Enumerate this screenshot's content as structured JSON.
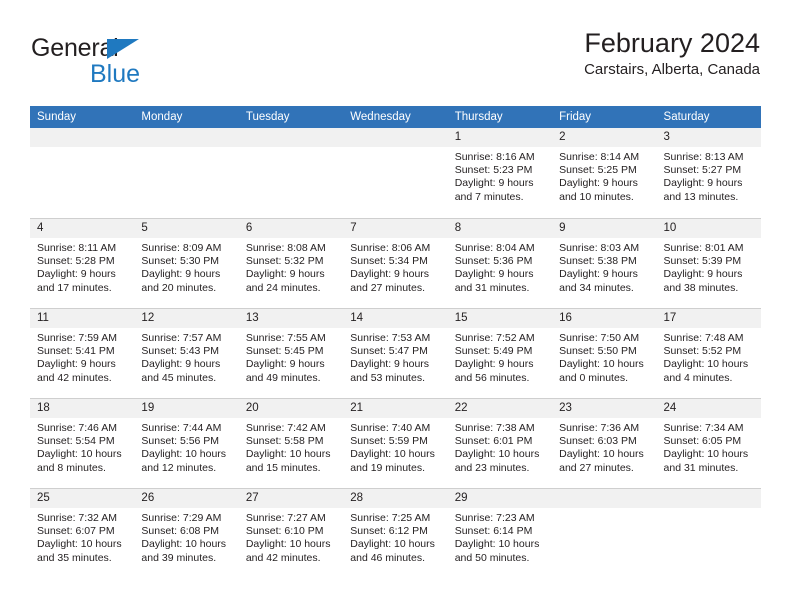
{
  "brand": {
    "name_top": "General",
    "name_bottom": "Blue",
    "triangle_color": "#1f79c0"
  },
  "header": {
    "title": "February 2024",
    "subtitle": "Carstairs, Alberta, Canada"
  },
  "theme": {
    "header_blue": "#3173b8",
    "day_band_gray": "#f1f1f1",
    "grid_line": "#cfcfcf",
    "text": "#231f20"
  },
  "calendar": {
    "weekdays": [
      "Sunday",
      "Monday",
      "Tuesday",
      "Wednesday",
      "Thursday",
      "Friday",
      "Saturday"
    ],
    "weeks": [
      [
        {
          "day": "",
          "sunrise": "",
          "sunset": "",
          "daylight1": "",
          "daylight2": ""
        },
        {
          "day": "",
          "sunrise": "",
          "sunset": "",
          "daylight1": "",
          "daylight2": ""
        },
        {
          "day": "",
          "sunrise": "",
          "sunset": "",
          "daylight1": "",
          "daylight2": ""
        },
        {
          "day": "",
          "sunrise": "",
          "sunset": "",
          "daylight1": "",
          "daylight2": ""
        },
        {
          "day": "1",
          "sunrise": "Sunrise: 8:16 AM",
          "sunset": "Sunset: 5:23 PM",
          "daylight1": "Daylight: 9 hours",
          "daylight2": "and 7 minutes."
        },
        {
          "day": "2",
          "sunrise": "Sunrise: 8:14 AM",
          "sunset": "Sunset: 5:25 PM",
          "daylight1": "Daylight: 9 hours",
          "daylight2": "and 10 minutes."
        },
        {
          "day": "3",
          "sunrise": "Sunrise: 8:13 AM",
          "sunset": "Sunset: 5:27 PM",
          "daylight1": "Daylight: 9 hours",
          "daylight2": "and 13 minutes."
        }
      ],
      [
        {
          "day": "4",
          "sunrise": "Sunrise: 8:11 AM",
          "sunset": "Sunset: 5:28 PM",
          "daylight1": "Daylight: 9 hours",
          "daylight2": "and 17 minutes."
        },
        {
          "day": "5",
          "sunrise": "Sunrise: 8:09 AM",
          "sunset": "Sunset: 5:30 PM",
          "daylight1": "Daylight: 9 hours",
          "daylight2": "and 20 minutes."
        },
        {
          "day": "6",
          "sunrise": "Sunrise: 8:08 AM",
          "sunset": "Sunset: 5:32 PM",
          "daylight1": "Daylight: 9 hours",
          "daylight2": "and 24 minutes."
        },
        {
          "day": "7",
          "sunrise": "Sunrise: 8:06 AM",
          "sunset": "Sunset: 5:34 PM",
          "daylight1": "Daylight: 9 hours",
          "daylight2": "and 27 minutes."
        },
        {
          "day": "8",
          "sunrise": "Sunrise: 8:04 AM",
          "sunset": "Sunset: 5:36 PM",
          "daylight1": "Daylight: 9 hours",
          "daylight2": "and 31 minutes."
        },
        {
          "day": "9",
          "sunrise": "Sunrise: 8:03 AM",
          "sunset": "Sunset: 5:38 PM",
          "daylight1": "Daylight: 9 hours",
          "daylight2": "and 34 minutes."
        },
        {
          "day": "10",
          "sunrise": "Sunrise: 8:01 AM",
          "sunset": "Sunset: 5:39 PM",
          "daylight1": "Daylight: 9 hours",
          "daylight2": "and 38 minutes."
        }
      ],
      [
        {
          "day": "11",
          "sunrise": "Sunrise: 7:59 AM",
          "sunset": "Sunset: 5:41 PM",
          "daylight1": "Daylight: 9 hours",
          "daylight2": "and 42 minutes."
        },
        {
          "day": "12",
          "sunrise": "Sunrise: 7:57 AM",
          "sunset": "Sunset: 5:43 PM",
          "daylight1": "Daylight: 9 hours",
          "daylight2": "and 45 minutes."
        },
        {
          "day": "13",
          "sunrise": "Sunrise: 7:55 AM",
          "sunset": "Sunset: 5:45 PM",
          "daylight1": "Daylight: 9 hours",
          "daylight2": "and 49 minutes."
        },
        {
          "day": "14",
          "sunrise": "Sunrise: 7:53 AM",
          "sunset": "Sunset: 5:47 PM",
          "daylight1": "Daylight: 9 hours",
          "daylight2": "and 53 minutes."
        },
        {
          "day": "15",
          "sunrise": "Sunrise: 7:52 AM",
          "sunset": "Sunset: 5:49 PM",
          "daylight1": "Daylight: 9 hours",
          "daylight2": "and 56 minutes."
        },
        {
          "day": "16",
          "sunrise": "Sunrise: 7:50 AM",
          "sunset": "Sunset: 5:50 PM",
          "daylight1": "Daylight: 10 hours",
          "daylight2": "and 0 minutes."
        },
        {
          "day": "17",
          "sunrise": "Sunrise: 7:48 AM",
          "sunset": "Sunset: 5:52 PM",
          "daylight1": "Daylight: 10 hours",
          "daylight2": "and 4 minutes."
        }
      ],
      [
        {
          "day": "18",
          "sunrise": "Sunrise: 7:46 AM",
          "sunset": "Sunset: 5:54 PM",
          "daylight1": "Daylight: 10 hours",
          "daylight2": "and 8 minutes."
        },
        {
          "day": "19",
          "sunrise": "Sunrise: 7:44 AM",
          "sunset": "Sunset: 5:56 PM",
          "daylight1": "Daylight: 10 hours",
          "daylight2": "and 12 minutes."
        },
        {
          "day": "20",
          "sunrise": "Sunrise: 7:42 AM",
          "sunset": "Sunset: 5:58 PM",
          "daylight1": "Daylight: 10 hours",
          "daylight2": "and 15 minutes."
        },
        {
          "day": "21",
          "sunrise": "Sunrise: 7:40 AM",
          "sunset": "Sunset: 5:59 PM",
          "daylight1": "Daylight: 10 hours",
          "daylight2": "and 19 minutes."
        },
        {
          "day": "22",
          "sunrise": "Sunrise: 7:38 AM",
          "sunset": "Sunset: 6:01 PM",
          "daylight1": "Daylight: 10 hours",
          "daylight2": "and 23 minutes."
        },
        {
          "day": "23",
          "sunrise": "Sunrise: 7:36 AM",
          "sunset": "Sunset: 6:03 PM",
          "daylight1": "Daylight: 10 hours",
          "daylight2": "and 27 minutes."
        },
        {
          "day": "24",
          "sunrise": "Sunrise: 7:34 AM",
          "sunset": "Sunset: 6:05 PM",
          "daylight1": "Daylight: 10 hours",
          "daylight2": "and 31 minutes."
        }
      ],
      [
        {
          "day": "25",
          "sunrise": "Sunrise: 7:32 AM",
          "sunset": "Sunset: 6:07 PM",
          "daylight1": "Daylight: 10 hours",
          "daylight2": "and 35 minutes."
        },
        {
          "day": "26",
          "sunrise": "Sunrise: 7:29 AM",
          "sunset": "Sunset: 6:08 PM",
          "daylight1": "Daylight: 10 hours",
          "daylight2": "and 39 minutes."
        },
        {
          "day": "27",
          "sunrise": "Sunrise: 7:27 AM",
          "sunset": "Sunset: 6:10 PM",
          "daylight1": "Daylight: 10 hours",
          "daylight2": "and 42 minutes."
        },
        {
          "day": "28",
          "sunrise": "Sunrise: 7:25 AM",
          "sunset": "Sunset: 6:12 PM",
          "daylight1": "Daylight: 10 hours",
          "daylight2": "and 46 minutes."
        },
        {
          "day": "29",
          "sunrise": "Sunrise: 7:23 AM",
          "sunset": "Sunset: 6:14 PM",
          "daylight1": "Daylight: 10 hours",
          "daylight2": "and 50 minutes."
        },
        {
          "day": "",
          "sunrise": "",
          "sunset": "",
          "daylight1": "",
          "daylight2": ""
        },
        {
          "day": "",
          "sunrise": "",
          "sunset": "",
          "daylight1": "",
          "daylight2": ""
        }
      ]
    ]
  }
}
